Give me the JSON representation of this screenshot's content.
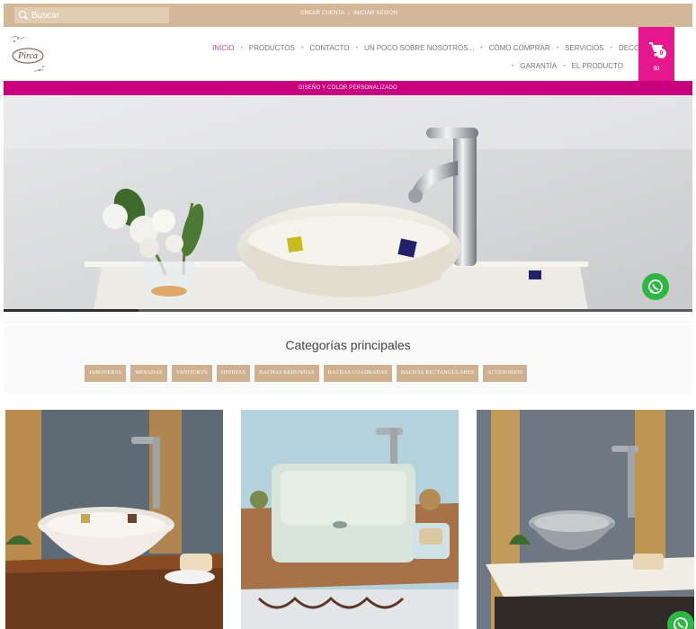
{
  "topbar": {
    "search_placeholder": "Buscar",
    "create_account": "CREAR CUENTA",
    "separator": "|",
    "login": "INICIAR SESIÓN"
  },
  "nav": {
    "items": [
      "INICIO",
      "PRODUCTOS",
      "CONTACTO",
      "UN POCO SOBRE NOSOTROS...",
      "CÓMO COMPRAR",
      "SERVICIOS",
      "DECORACIÓN",
      "GARANTÍA",
      "EL PRODUCTO"
    ],
    "active": "INICIO"
  },
  "cart": {
    "count": "0",
    "total": "$0"
  },
  "promo": {
    "text": "DISEÑO Y COLOR PERSONALIZADO"
  },
  "categories": {
    "title": "Categorías principales",
    "items": [
      "JABONERAS",
      "MESADAS",
      "VANITORYS",
      "OFERTAS",
      "BACHAS REDONDAS",
      "BACHAS CUADRADAS",
      "BACHAS RECTANGULARES",
      "ACCESORIOS"
    ]
  },
  "logo": {
    "text": "Pirca"
  },
  "colors": {
    "topbar": "#d2b899",
    "accent_pink": "#e5178e",
    "promo_bar": "#c8007e",
    "category_button": "#cfb190",
    "whatsapp": "#2db742"
  },
  "icons": {
    "search": "search-icon",
    "cart": "cart-icon",
    "next": "chevron-right-icon",
    "whatsapp": "whatsapp-icon"
  }
}
